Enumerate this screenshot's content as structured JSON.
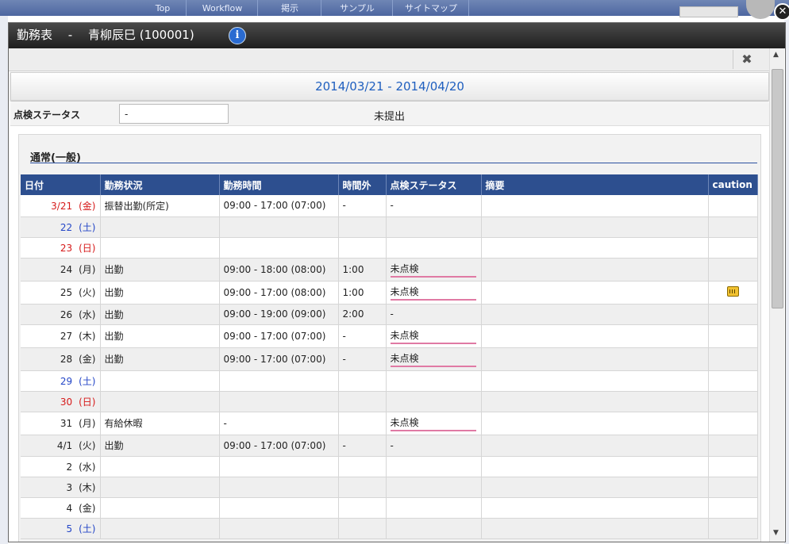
{
  "background_nav": {
    "tabs": [
      "Top",
      "Workflow",
      "掲示",
      "サンプル",
      "サイトマップ"
    ]
  },
  "dialog": {
    "title": "勤務表　 -　 青柳辰巳 (100001)",
    "period": "2014/03/21 - 2014/04/20",
    "status_label": "点検ステータス",
    "status_value": "-",
    "status_text": "未提出"
  },
  "section": {
    "title": "通常(一般)"
  },
  "table": {
    "headers": [
      "日付",
      "勤務状況",
      "勤務時間",
      "時間外",
      "点検ステータス",
      "摘要",
      "caution"
    ],
    "rows": [
      {
        "day": "3/21",
        "dow": "(金)",
        "status": "振替出勤(所定)",
        "time": "09:00 - 17:00 (07:00)",
        "overtime": "-",
        "check": "-",
        "check_flag": false,
        "caution": false,
        "day_color": "red"
      },
      {
        "day": "22",
        "dow": "(土)",
        "status": "",
        "time": "",
        "overtime": "",
        "check": "",
        "check_flag": false,
        "caution": false,
        "day_color": "sat"
      },
      {
        "day": "23",
        "dow": "(日)",
        "status": "",
        "time": "",
        "overtime": "",
        "check": "",
        "check_flag": false,
        "caution": false,
        "day_color": "sun"
      },
      {
        "day": "24",
        "dow": "(月)",
        "status": "出勤",
        "time": "09:00 - 18:00 (08:00)",
        "overtime": "1:00",
        "check": "未点検",
        "check_flag": true,
        "caution": false,
        "day_color": ""
      },
      {
        "day": "25",
        "dow": "(火)",
        "status": "出勤",
        "time": "09:00 - 17:00 (08:00)",
        "overtime": "1:00",
        "check": "未点検",
        "check_flag": true,
        "caution": true,
        "day_color": ""
      },
      {
        "day": "26",
        "dow": "(水)",
        "status": "出勤",
        "time": "09:00 - 19:00 (09:00)",
        "overtime": "2:00",
        "check": "-",
        "check_flag": false,
        "caution": false,
        "day_color": ""
      },
      {
        "day": "27",
        "dow": "(木)",
        "status": "出勤",
        "time": "09:00 - 17:00 (07:00)",
        "overtime": "-",
        "check": "未点検",
        "check_flag": true,
        "caution": false,
        "day_color": ""
      },
      {
        "day": "28",
        "dow": "(金)",
        "status": "出勤",
        "time": "09:00 - 17:00 (07:00)",
        "overtime": "-",
        "check": "未点検",
        "check_flag": true,
        "caution": false,
        "day_color": ""
      },
      {
        "day": "29",
        "dow": "(土)",
        "status": "",
        "time": "",
        "overtime": "",
        "check": "",
        "check_flag": false,
        "caution": false,
        "day_color": "sat"
      },
      {
        "day": "30",
        "dow": "(日)",
        "status": "",
        "time": "",
        "overtime": "",
        "check": "",
        "check_flag": false,
        "caution": false,
        "day_color": "sun"
      },
      {
        "day": "31",
        "dow": "(月)",
        "status": "有給休暇",
        "time": "-",
        "overtime": "",
        "check": "未点検",
        "check_flag": true,
        "caution": false,
        "day_color": ""
      },
      {
        "day": "4/1",
        "dow": "(火)",
        "status": "出勤",
        "time": "09:00 - 17:00 (07:00)",
        "overtime": "-",
        "check": "-",
        "check_flag": false,
        "caution": false,
        "day_color": ""
      },
      {
        "day": "2",
        "dow": "(水)",
        "status": "",
        "time": "",
        "overtime": "",
        "check": "",
        "check_flag": false,
        "caution": false,
        "day_color": ""
      },
      {
        "day": "3",
        "dow": "(木)",
        "status": "",
        "time": "",
        "overtime": "",
        "check": "",
        "check_flag": false,
        "caution": false,
        "day_color": ""
      },
      {
        "day": "4",
        "dow": "(金)",
        "status": "",
        "time": "",
        "overtime": "",
        "check": "",
        "check_flag": false,
        "caution": false,
        "day_color": ""
      },
      {
        "day": "5",
        "dow": "(土)",
        "status": "",
        "time": "",
        "overtime": "",
        "check": "",
        "check_flag": false,
        "caution": false,
        "day_color": "sat"
      }
    ]
  },
  "icons": {
    "info": "info-icon",
    "close": "close-icon",
    "caution": "caution-icon"
  }
}
